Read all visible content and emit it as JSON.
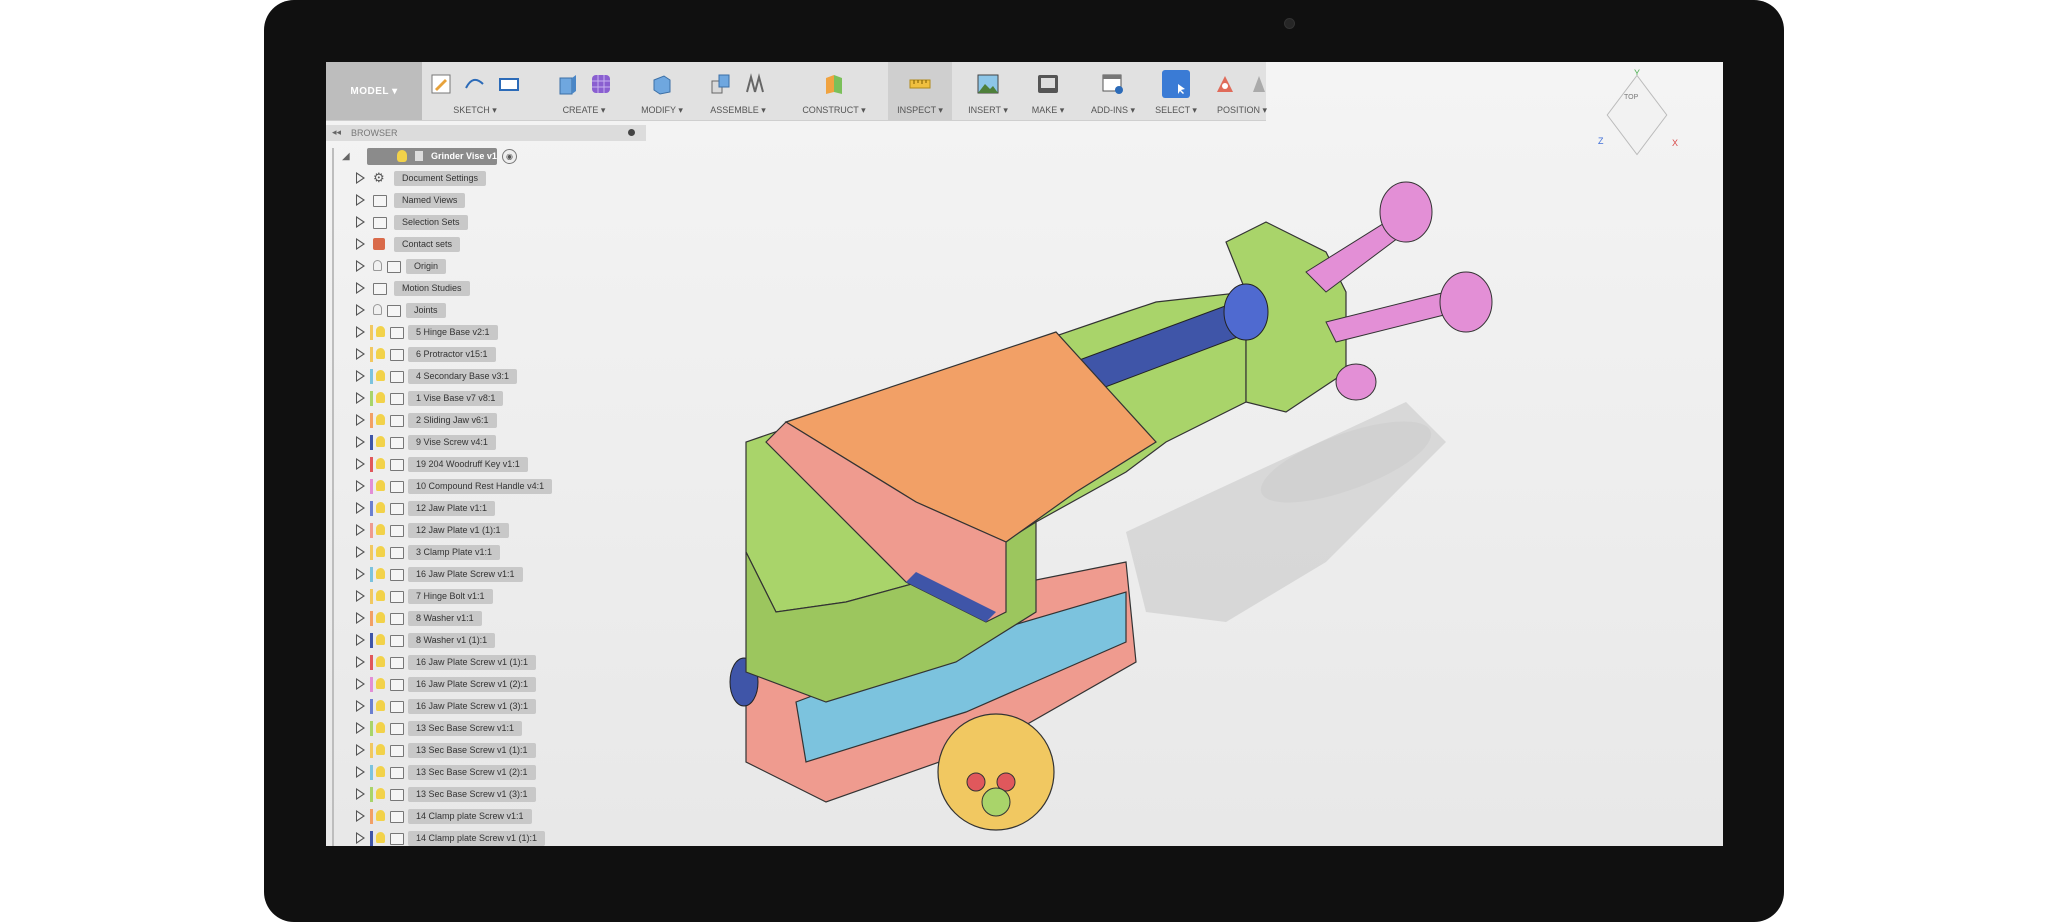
{
  "toolbar": {
    "model_label": "MODEL ▾",
    "groups": [
      {
        "label": "SKETCH ▾"
      },
      {
        "label": "CREATE ▾"
      },
      {
        "label": "MODIFY ▾"
      },
      {
        "label": "ASSEMBLE ▾"
      },
      {
        "label": "CONSTRUCT ▾"
      },
      {
        "label": "INSPECT ▾"
      },
      {
        "label": "INSERT ▾"
      },
      {
        "label": "MAKE ▾"
      },
      {
        "label": "ADD-INS ▾"
      },
      {
        "label": "SELECT ▾"
      },
      {
        "label": "POSITION ▾"
      }
    ]
  },
  "browser": {
    "title": "BROWSER",
    "root": "Grinder Vise v1",
    "items": [
      {
        "label": "Document Settings"
      },
      {
        "label": "Named Views"
      },
      {
        "label": "Selection Sets"
      },
      {
        "label": "Contact sets"
      },
      {
        "label": "Origin"
      },
      {
        "label": "Motion Studies"
      },
      {
        "label": "Joints"
      },
      {
        "label": "5 Hinge Base v2:1"
      },
      {
        "label": "6 Protractor v15:1"
      },
      {
        "label": "4 Secondary Base v3:1"
      },
      {
        "label": "1 Vise Base v7 v8:1"
      },
      {
        "label": "2 Sliding Jaw v6:1"
      },
      {
        "label": "9 Vise Screw v4:1"
      },
      {
        "label": "19 204 Woodruff Key v1:1"
      },
      {
        "label": "10 Compound Rest Handle v4:1"
      },
      {
        "label": "12 Jaw Plate v1:1"
      },
      {
        "label": "12 Jaw Plate v1 (1):1"
      },
      {
        "label": "3 Clamp Plate v1:1"
      },
      {
        "label": "16 Jaw Plate Screw v1:1"
      },
      {
        "label": "7 Hinge Bolt v1:1"
      },
      {
        "label": "8 Washer v1:1"
      },
      {
        "label": "8 Washer v1 (1):1"
      },
      {
        "label": "16 Jaw Plate Screw v1 (1):1"
      },
      {
        "label": "16 Jaw Plate Screw v1 (2):1"
      },
      {
        "label": "16 Jaw Plate Screw v1 (3):1"
      },
      {
        "label": "13 Sec Base Screw v1:1"
      },
      {
        "label": "13 Sec Base Screw v1 (1):1"
      },
      {
        "label": "13 Sec Base Screw v1 (2):1"
      },
      {
        "label": "13 Sec Base Screw v1 (3):1"
      },
      {
        "label": "14 Clamp plate Screw v1:1"
      },
      {
        "label": "14 Clamp plate Screw v1 (1):1"
      }
    ]
  },
  "viewcube": {
    "top": "TOP",
    "y": "Y",
    "z": "Z",
    "x": "X"
  },
  "colors": {
    "green": "#a9d46a",
    "orange": "#f2a066",
    "salmon": "#ef9b8f",
    "blue": "#7cc3de",
    "pink": "#e38fd6",
    "navy": "#3f55a8",
    "yellow": "#f1c861"
  }
}
